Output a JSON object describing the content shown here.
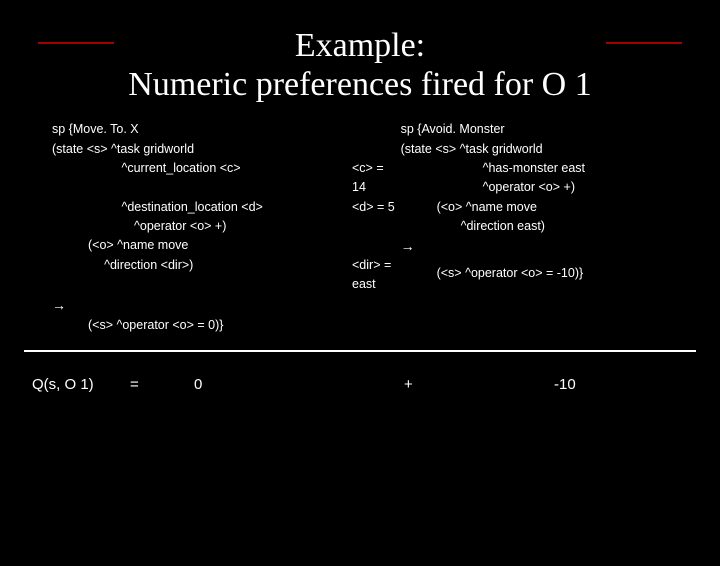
{
  "title_line1": "Example:",
  "title_line2": "Numeric preferences fired for O 1",
  "left": {
    "l1": "sp {Move. To. X",
    "l2": "(state <s> ^task gridworld",
    "l3a": "^current_location <c>",
    "l3b": "<c> = 14",
    "l4a": "^destination_location <d>",
    "l4b": "<d> = 5",
    "l5": "^operator <o> +)",
    "l6": "(<o> ^name move",
    "l7a": "^direction <dir>)",
    "l7b": "<dir> = east",
    "arrow": "→",
    "l9": "(<s> ^operator <o> = 0)}"
  },
  "right": {
    "r1": "sp {Avoid. Monster",
    "r2": "(state <s> ^task gridworld",
    "r3": "^has-monster east",
    "r4": "^operator <o> +)",
    "r5": "(<o> ^name move",
    "r6": "^direction east)",
    "arrow": "→",
    "r8": "(<s> ^operator <o> = -10)}"
  },
  "eq": {
    "qs": "Q(s, O 1)",
    "equals": "=",
    "zero": "0",
    "plus": "+",
    "minus": "-10"
  }
}
